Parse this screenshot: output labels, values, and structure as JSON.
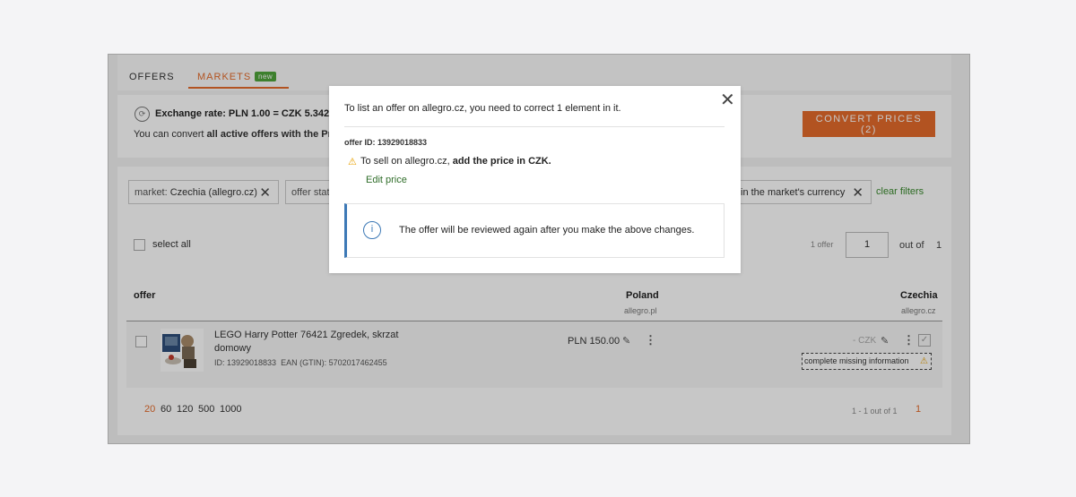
{
  "tabs": [
    {
      "label": "OFFERS"
    },
    {
      "label": "MARKETS",
      "badge": "new"
    }
  ],
  "exchange": {
    "title": "Exchange rate: PLN 1.00 = CZK 5.34212",
    "desc_prefix": "You can convert ",
    "desc_bold": "all active offers with the Pr"
  },
  "convert_button": "CONVERT PRICES (2)",
  "filters": {
    "chip1_label": "market: ",
    "chip1_value": "Czechia (allegro.cz)",
    "chip2": "offer stat",
    "chip3": "in the market's currency",
    "clear": "clear filters"
  },
  "list": {
    "select_all": "select all",
    "pager_label": "1 offer",
    "page_value": "1",
    "out_of": "out of",
    "total_pages": "1"
  },
  "table": {
    "col_offer": "offer",
    "col_poland": "Poland",
    "col_poland_sub": "allegro.pl",
    "col_czechia": "Czechia",
    "col_czechia_sub": "allegro.cz"
  },
  "row": {
    "name": "LEGO Harry Potter 76421 Zgredek, skrzat domowy",
    "id": "ID: 13929018833",
    "ean": "EAN (GTIN): 5702017462455",
    "price_pl": "PLN 150.00",
    "price_cz": "- CZK",
    "missing": "complete missing information"
  },
  "pagination": {
    "per_page": [
      "20",
      "60",
      "120",
      "500",
      "1000"
    ],
    "range": "1 - 1 out of 1",
    "page": "1"
  },
  "modal": {
    "title": "To list an offer on allegro.cz, you need to correct 1 element in it.",
    "offer_id": "offer ID: 13929018833",
    "warn_prefix": "To sell on allegro.cz, ",
    "warn_bold": "add the price in CZK.",
    "edit": "Edit price",
    "info": "The offer will be reviewed again after you make the above changes."
  },
  "colors": {
    "accent": "#e46b2b",
    "green": "#4fa43a",
    "info_blue": "#3d79b6",
    "warning": "#e8a000"
  }
}
